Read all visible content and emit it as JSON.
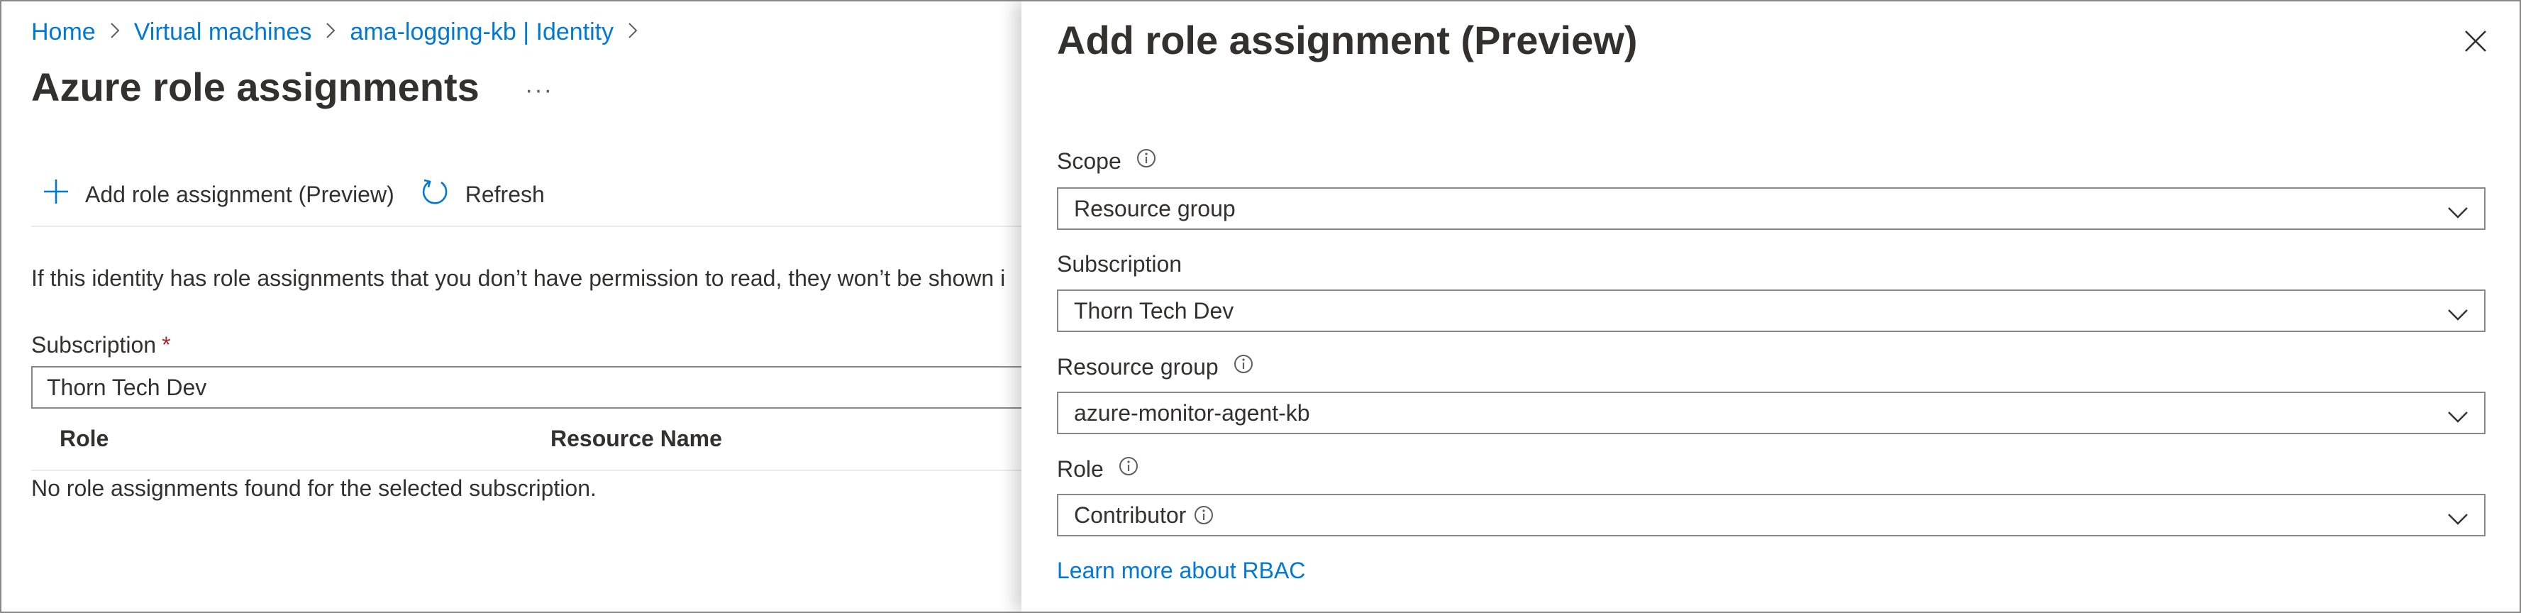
{
  "breadcrumb": {
    "items": [
      "Home",
      "Virtual machines",
      "ama-logging-kb | Identity"
    ]
  },
  "page": {
    "title": "Azure role assignments",
    "more": "···"
  },
  "toolbar": {
    "add_label": "Add role assignment (Preview)",
    "refresh_label": "Refresh"
  },
  "notice": "If this identity has role assignments that you don’t have permission to read, they won’t be shown i",
  "subscription_filter": {
    "label": "Subscription",
    "required_mark": "*",
    "value": "Thorn Tech Dev"
  },
  "table": {
    "columns": [
      "Role",
      "Resource Name"
    ],
    "empty_message": "No role assignments found for the selected subscription."
  },
  "panel": {
    "title": "Add role assignment (Preview)",
    "fields": {
      "scope": {
        "label": "Scope",
        "value": "Resource group"
      },
      "subscription": {
        "label": "Subscription",
        "value": "Thorn Tech Dev"
      },
      "resource_group": {
        "label": "Resource group",
        "value": "azure-monitor-agent-kb"
      },
      "role": {
        "label": "Role",
        "value": "Contributor"
      }
    },
    "learn_more": "Learn more about RBAC"
  },
  "icons": {
    "add": "plus-icon",
    "refresh": "refresh-icon",
    "close": "close-icon",
    "info": "info-icon",
    "chevron": "chevron-down-icon",
    "breadcrumb_separator": "chevron-right-icon"
  },
  "colors": {
    "link": "#0078d4",
    "text": "#323130",
    "border": "#8a8886",
    "required": "#a4262c"
  }
}
